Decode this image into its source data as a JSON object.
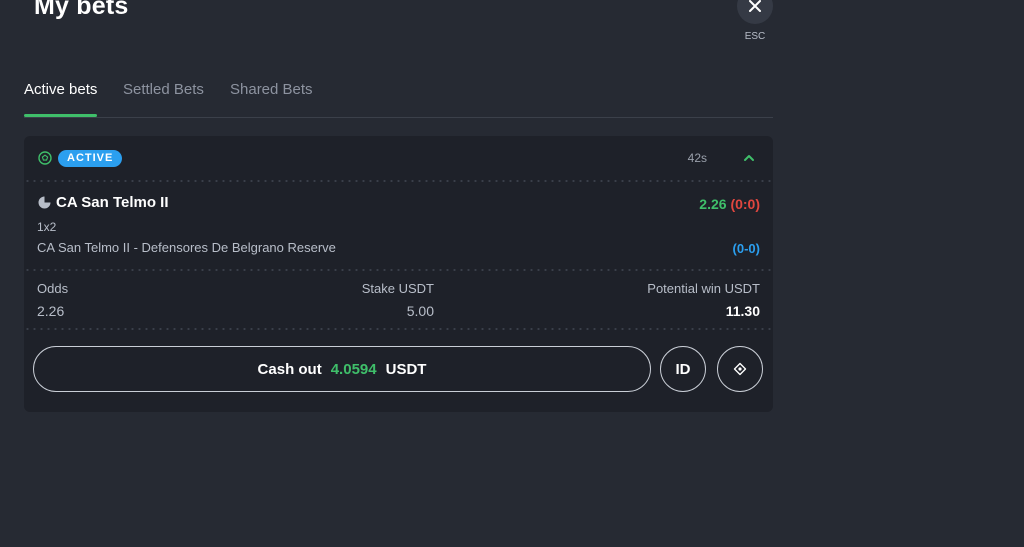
{
  "header": {
    "title": "My bets",
    "esc_label": "ESC"
  },
  "tabs": [
    {
      "label": "Active bets",
      "active": true
    },
    {
      "label": "Settled Bets",
      "active": false
    },
    {
      "label": "Shared Bets",
      "active": false
    }
  ],
  "bet": {
    "status": "ACTIVE",
    "timer": "42s",
    "team": "CA San Telmo II",
    "odds": "2.26",
    "score": "(0:0)",
    "market": "1x2",
    "event": "CA San Telmo II - Defensores De Belgrano Reserve",
    "live_score": "(0-0)",
    "stats": {
      "odds_label": "Odds",
      "odds_value": "2.26",
      "stake_label": "Stake USDT",
      "stake_value": "5.00",
      "win_label": "Potential win USDT",
      "win_value": "11.30"
    },
    "cashout": {
      "label": "Cash out",
      "amount": "4.0594",
      "currency": "USDT"
    },
    "id_button": "ID"
  },
  "colors": {
    "accent_green": "#3fbf6a",
    "badge_blue": "#2b9fef",
    "score_red": "#e0463f"
  },
  "icons": [
    "close-icon",
    "football-icon",
    "chevron-up-icon",
    "team-icon",
    "share-icon"
  ]
}
